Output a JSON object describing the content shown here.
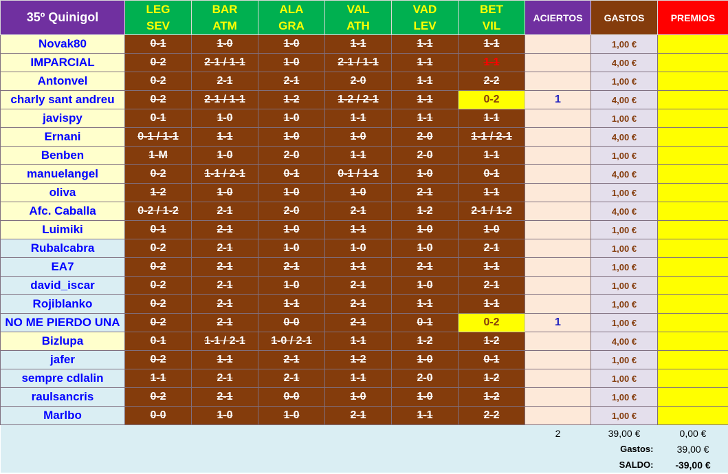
{
  "title": "35º Quinigol",
  "matches": [
    {
      "home": "LEG",
      "away": "SEV"
    },
    {
      "home": "BAR",
      "away": "ATM"
    },
    {
      "home": "ALA",
      "away": "GRA"
    },
    {
      "home": "VAL",
      "away": "ATH"
    },
    {
      "home": "VAD",
      "away": "LEV"
    },
    {
      "home": "BET",
      "away": "VIL"
    }
  ],
  "headers": {
    "aciertos": "ACIERTOS",
    "gastos": "GASTOS",
    "premios": "PREMIOS"
  },
  "rows": [
    {
      "name": "Novak80",
      "picks": [
        "0-1",
        "1-0",
        "1-0",
        "1-1",
        "1-1",
        "1-1"
      ],
      "aciertos": "",
      "gastos": "1,00 €"
    },
    {
      "name": "IMPARCIAL",
      "picks": [
        "0-2",
        "2-1 / 1-1",
        "1-0",
        "2-1 / 1-1",
        "1-1",
        "1-1"
      ],
      "aciertos": "",
      "gastos": "4,00 €"
    },
    {
      "name": "Antonvel",
      "picks": [
        "0-2",
        "2-1",
        "2-1",
        "2-0",
        "1-1",
        "2-2"
      ],
      "aciertos": "",
      "gastos": "1,00 €"
    },
    {
      "name": "charly sant andreu",
      "picks": [
        "0-2",
        "2-1 / 1-1",
        "1-2",
        "1-2 / 2-1",
        "1-1",
        "0-2"
      ],
      "aciertos": "1",
      "gastos": "4,00 €"
    },
    {
      "name": "javispy",
      "picks": [
        "0-1",
        "1-0",
        "1-0",
        "1-1",
        "1-1",
        "1-1"
      ],
      "aciertos": "",
      "gastos": "1,00 €"
    },
    {
      "name": "Ernani",
      "picks": [
        "0-1 / 1-1",
        "1-1",
        "1-0",
        "1-0",
        "2-0",
        "1-1 / 2-1"
      ],
      "aciertos": "",
      "gastos": "4,00 €"
    },
    {
      "name": "Benben",
      "picks": [
        "1-M",
        "1-0",
        "2-0",
        "1-1",
        "2-0",
        "1-1"
      ],
      "aciertos": "",
      "gastos": "1,00 €"
    },
    {
      "name": "manuelangel",
      "picks": [
        "0-2",
        "1-1 / 2-1",
        "0-1",
        "0-1 / 1-1",
        "1-0",
        "0-1"
      ],
      "aciertos": "",
      "gastos": "4,00 €"
    },
    {
      "name": "oliva",
      "picks": [
        "1-2",
        "1-0",
        "1-0",
        "1-0",
        "2-1",
        "1-1"
      ],
      "aciertos": "",
      "gastos": "1,00 €"
    },
    {
      "name": "Afc. Caballa",
      "picks": [
        "0-2 / 1-2",
        "2-1",
        "2-0",
        "2-1",
        "1-2",
        "2-1 / 1-2"
      ],
      "aciertos": "",
      "gastos": "4,00 €"
    },
    {
      "name": "Luimiki",
      "picks": [
        "0-1",
        "2-1",
        "1-0",
        "1-1",
        "1-0",
        "1-0"
      ],
      "aciertos": "",
      "gastos": "1,00 €"
    },
    {
      "name": "Rubalcabra",
      "picks": [
        "0-2",
        "2-1",
        "1-0",
        "1-0",
        "1-0",
        "2-1"
      ],
      "aciertos": "",
      "gastos": "1,00 €"
    },
    {
      "name": "EA7",
      "picks": [
        "0-2",
        "2-1",
        "2-1",
        "1-1",
        "2-1",
        "1-1"
      ],
      "aciertos": "",
      "gastos": "1,00 €"
    },
    {
      "name": "david_iscar",
      "picks": [
        "0-2",
        "2-1",
        "1-0",
        "2-1",
        "1-0",
        "2-1"
      ],
      "aciertos": "",
      "gastos": "1,00 €"
    },
    {
      "name": "Rojiblanko",
      "picks": [
        "0-2",
        "2-1",
        "1-1",
        "2-1",
        "1-1",
        "1-1"
      ],
      "aciertos": "",
      "gastos": "1,00 €"
    },
    {
      "name": "NO ME PIERDO UNA",
      "picks": [
        "0-2",
        "2-1",
        "0-0",
        "2-1",
        "0-1",
        "0-2"
      ],
      "aciertos": "1",
      "gastos": "1,00 €"
    },
    {
      "name": "Bizlupa",
      "picks": [
        "0-1",
        "1-1 / 2-1",
        "1-0 / 2-1",
        "1-1",
        "1-2",
        "1-2"
      ],
      "aciertos": "",
      "gastos": "4,00 €"
    },
    {
      "name": "jafer",
      "picks": [
        "0-2",
        "1-1",
        "2-1",
        "1-2",
        "1-0",
        "0-1"
      ],
      "aciertos": "",
      "gastos": "1,00 €"
    },
    {
      "name": "sempre cdlalin",
      "picks": [
        "1-1",
        "2-1",
        "2-1",
        "1-1",
        "2-0",
        "1-2"
      ],
      "aciertos": "",
      "gastos": "1,00 €"
    },
    {
      "name": "raulsancris",
      "picks": [
        "0-2",
        "2-1",
        "0-0",
        "1-0",
        "1-0",
        "1-2"
      ],
      "aciertos": "",
      "gastos": "1,00 €"
    },
    {
      "name": "Marlbo",
      "picks": [
        "0-0",
        "1-0",
        "1-0",
        "2-1",
        "1-1",
        "2-2"
      ],
      "aciertos": "",
      "gastos": "1,00 €"
    }
  ],
  "totals": {
    "aciertos": "2",
    "gastos": "39,00 €",
    "premios": "0,00 €"
  },
  "summary": {
    "gastos_label": "Gastos:",
    "gastos_value": "39,00 €",
    "saldo_label": "SALDO:",
    "saldo_value": "-39,00 €"
  }
}
